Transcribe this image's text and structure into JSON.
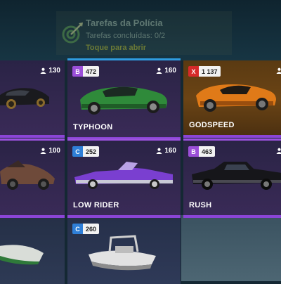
{
  "quest": {
    "title": "Tarefas da Polícia",
    "progress": "Tarefas concluídas: 0/2",
    "action": "Toque para abrir",
    "icon": "target-arrow-icon"
  },
  "colors": {
    "class_b": "#9b4fd8",
    "class_c": "#2f7fd8",
    "class_x": "#d62a2a",
    "selection_blue": "#2f9ce0",
    "rarity_purple": "#8b45d6"
  },
  "cards": [
    {
      "name": "",
      "class": "",
      "pi": "",
      "owners": "130"
    },
    {
      "name": "TYPHOON",
      "class": "B",
      "pi": "472",
      "owners": "160"
    },
    {
      "name": "GODSPEED",
      "class": "X",
      "pi": "1 137",
      "owners": ""
    },
    {
      "name": "",
      "class": "",
      "pi": "",
      "owners": "100"
    },
    {
      "name": "LOW RIDER",
      "class": "C",
      "pi": "252",
      "owners": "160"
    },
    {
      "name": "RUSH",
      "class": "B",
      "pi": "463",
      "owners": ""
    },
    {
      "name": "",
      "class": "",
      "pi": "",
      "owners": ""
    },
    {
      "name": "",
      "class": "C",
      "pi": "260",
      "owners": ""
    }
  ]
}
